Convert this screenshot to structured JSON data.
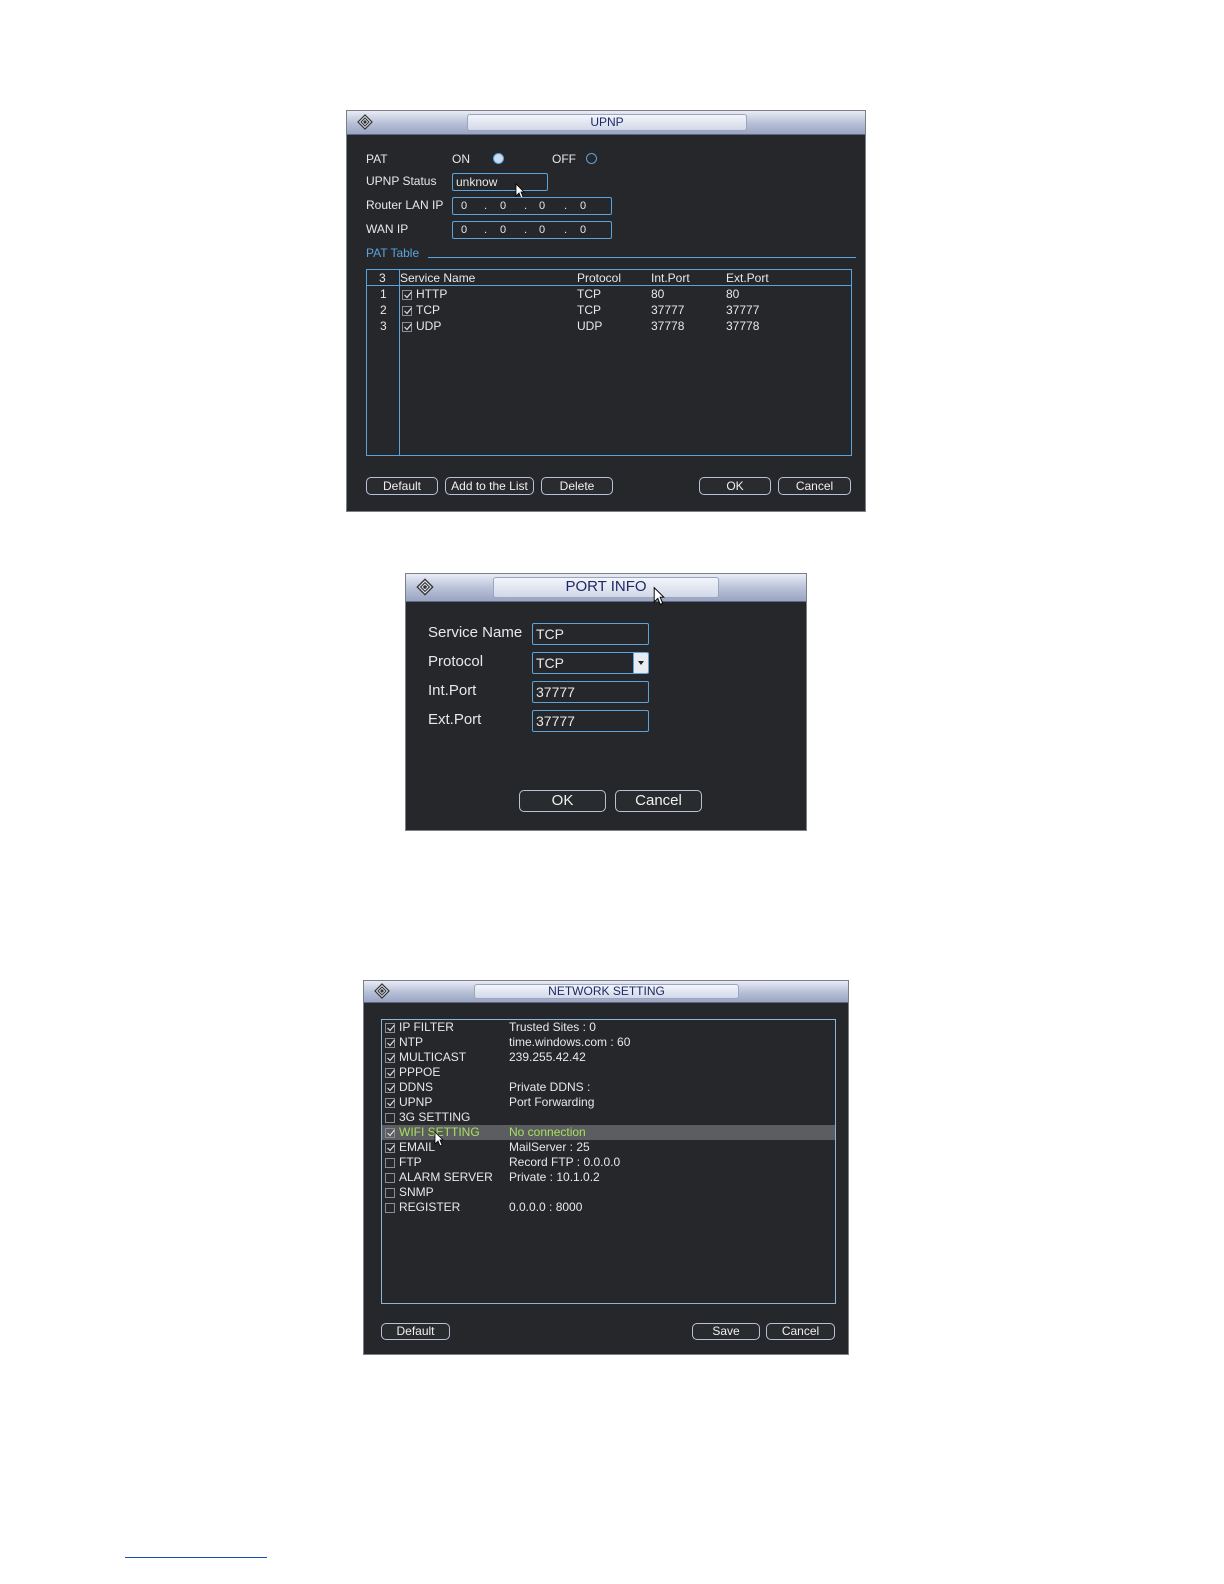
{
  "upnp": {
    "title": "UPNP",
    "pat_label": "PAT",
    "on_label": "ON",
    "off_label": "OFF",
    "pat_selected": "ON",
    "status_label": "UPNP Status",
    "status_value": "unknow",
    "router_lan_ip_label": "Router LAN IP",
    "router_lan_ip": [
      "0",
      "0",
      "0",
      "0"
    ],
    "wan_ip_label": "WAN IP",
    "wan_ip": [
      "0",
      "0",
      "0",
      "0"
    ],
    "pat_table_label": "PAT Table",
    "table": {
      "count": "3",
      "headers": [
        "Service Name",
        "Protocol",
        "Int.Port",
        "Ext.Port"
      ],
      "rows": [
        {
          "num": "1",
          "checked": true,
          "service": "HTTP",
          "protocol": "TCP",
          "int_port": "80",
          "ext_port": "80"
        },
        {
          "num": "2",
          "checked": true,
          "service": "TCP",
          "protocol": "TCP",
          "int_port": "37777",
          "ext_port": "37777"
        },
        {
          "num": "3",
          "checked": true,
          "service": "UDP",
          "protocol": "UDP",
          "int_port": "37778",
          "ext_port": "37778"
        }
      ]
    },
    "buttons": {
      "default": "Default",
      "add": "Add to the List",
      "delete": "Delete",
      "ok": "OK",
      "cancel": "Cancel"
    }
  },
  "port_info": {
    "title": "PORT INFO",
    "service_name_label": "Service Name",
    "service_name": "TCP",
    "protocol_label": "Protocol",
    "protocol": "TCP",
    "int_port_label": "Int.Port",
    "int_port": "37777",
    "ext_port_label": "Ext.Port",
    "ext_port": "37777",
    "buttons": {
      "ok": "OK",
      "cancel": "Cancel"
    }
  },
  "network": {
    "title": "NETWORK SETTING",
    "items": [
      {
        "checked": true,
        "name": "IP FILTER",
        "value": "Trusted Sites : 0"
      },
      {
        "checked": true,
        "name": "NTP",
        "value": "time.windows.com : 60"
      },
      {
        "checked": true,
        "name": "MULTICAST",
        "value": "239.255.42.42"
      },
      {
        "checked": true,
        "name": "PPPOE",
        "value": ""
      },
      {
        "checked": true,
        "name": "DDNS",
        "value": "Private DDNS :"
      },
      {
        "checked": true,
        "name": "UPNP",
        "value": "Port Forwarding"
      },
      {
        "checked": false,
        "name": "3G SETTING",
        "value": ""
      },
      {
        "checked": true,
        "name": "WIFI SETTING",
        "value": "No connection",
        "selected": true
      },
      {
        "checked": true,
        "name": "EMAIL",
        "value": "MailServer : 25"
      },
      {
        "checked": false,
        "name": "FTP",
        "value": "Record FTP : 0.0.0.0"
      },
      {
        "checked": false,
        "name": "ALARM SERVER",
        "value": "Private : 10.1.0.2"
      },
      {
        "checked": false,
        "name": "SNMP",
        "value": ""
      },
      {
        "checked": false,
        "name": "REGISTER",
        "value": "0.0.0.0 : 8000"
      }
    ],
    "highlight_color": "#a8e05a",
    "buttons": {
      "default": "Default",
      "save": "Save",
      "cancel": "Cancel"
    }
  }
}
